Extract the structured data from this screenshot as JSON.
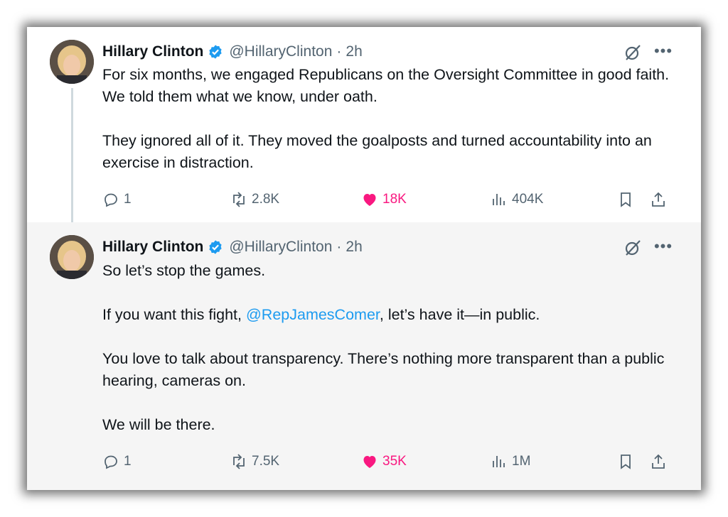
{
  "tweets": [
    {
      "author_name": "Hillary Clinton",
      "handle": "@HillaryClinton",
      "separator": "·",
      "time": "2h",
      "paragraphs": [
        "For six months, we engaged Republicans on the Oversight Committee in good faith. We told them what we know, under oath.",
        "They ignored all of it. They moved the goalposts and turned accountability into an exercise in distraction."
      ],
      "stats": {
        "replies": "1",
        "reposts": "2.8K",
        "likes": "18K",
        "views": "404K"
      }
    },
    {
      "author_name": "Hillary Clinton",
      "handle": "@HillaryClinton",
      "separator": "·",
      "time": "2h",
      "line1": "So let’s stop the games.",
      "line2_pre": "If you want this fight, ",
      "mention": "@RepJamesComer",
      "line2_post": ", let’s have it—in public.",
      "line3": "You love to talk about transparency. There’s nothing more transparent than a public hearing, cameras on.",
      "line4": "We will be there.",
      "stats": {
        "replies": "1",
        "reposts": "7.5K",
        "likes": "35K",
        "views": "1M"
      }
    }
  ],
  "colors": {
    "link": "#1d9bf0",
    "like": "#f91880",
    "verified": "#1d9bf0",
    "muted": "#536471"
  },
  "icons": [
    "verified-badge-icon",
    "grok-icon",
    "more-icon",
    "reply-icon",
    "repost-icon",
    "like-icon",
    "views-icon",
    "bookmark-icon",
    "share-icon"
  ]
}
